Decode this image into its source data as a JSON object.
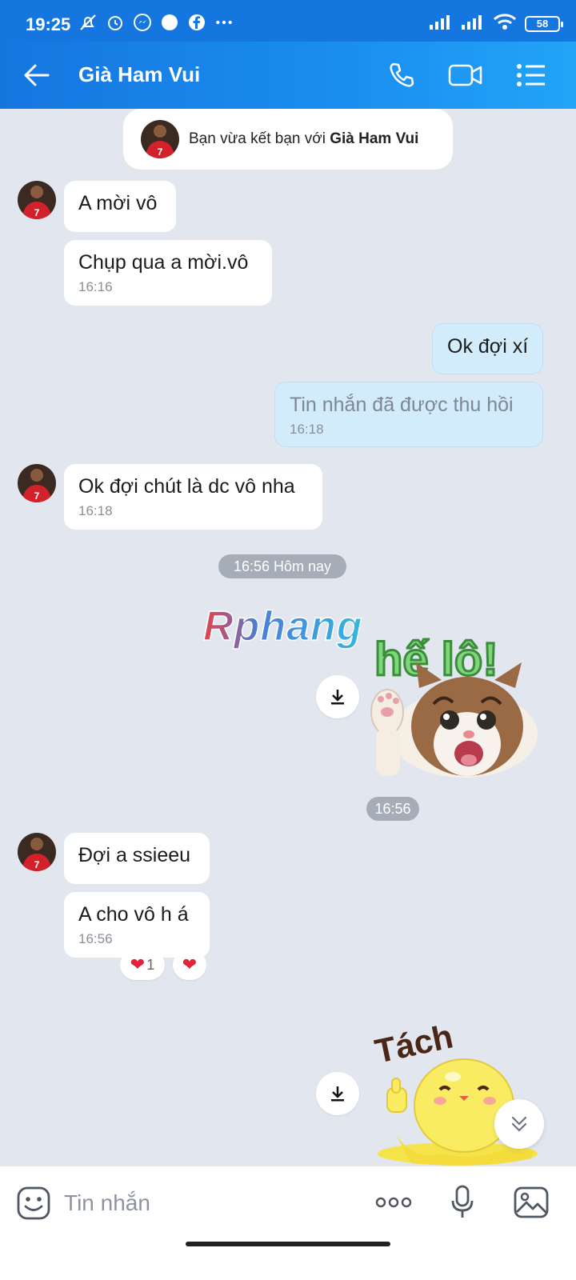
{
  "status_bar": {
    "time": "19:25",
    "battery": "58"
  },
  "header": {
    "title": "Già Ham Vui"
  },
  "notice": {
    "prefix": "Bạn vừa kết bạn với ",
    "name": "Già Ham Vui"
  },
  "messages": [
    {
      "text": "A mời vô"
    },
    {
      "text": "Chụp qua a mời.vô",
      "time": "16:16"
    },
    {
      "text": "Ok đợi xí"
    },
    {
      "text": "Tin nhắn đã được thu hồi",
      "time": "16:18"
    },
    {
      "text": "Ok đợi chút là dc vô nha",
      "time": "16:18"
    },
    {
      "text": "Đợi a ssieeu"
    },
    {
      "text": "A cho vô h á",
      "time": "16:56"
    }
  ],
  "separators": {
    "day": "16:56 Hôm nay",
    "time": "16:56"
  },
  "stickers": {
    "hello_text": "hế lô!",
    "tach_text": "Tách"
  },
  "watermark": "Rphang",
  "reactions": {
    "heart_count": "1"
  },
  "input": {
    "placeholder": "Tin nhắn"
  },
  "colors": {
    "header": "#1a8ef0",
    "chat_bg": "#e2e7ef",
    "my_bubble": "#d3ecfb"
  }
}
